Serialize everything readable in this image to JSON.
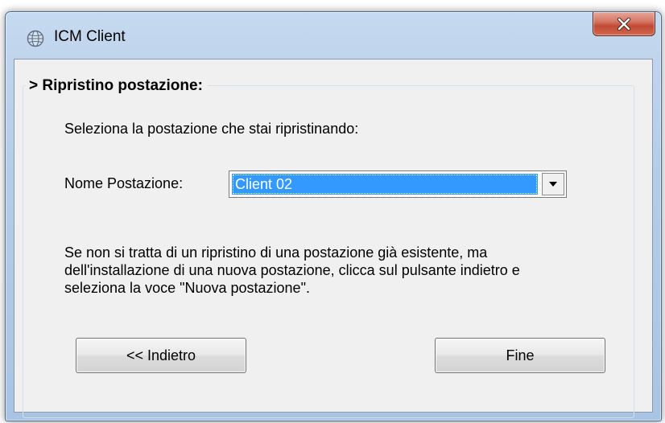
{
  "window": {
    "title": "ICM Client",
    "icon": "app-globe-icon",
    "close_icon": "close-x-icon",
    "close_glyph": "X"
  },
  "group": {
    "marker": ">",
    "title": "Ripristino postazione:"
  },
  "instructions": "Seleziona la postazione che stai ripristinando:",
  "workstation": {
    "label": "Nome Postazione:",
    "selected_value": "Client 02",
    "dropdown_icon": "chevron-down-icon"
  },
  "info_text": {
    "line1": "Se non si tratta di un ripristino di una postazione già esistente, ma",
    "line2": "dell'installazione di una nuova postazione, clicca sul pulsante indietro e",
    "line3": "seleziona la voce \"Nuova postazione\"."
  },
  "buttons": {
    "back_label": "<< Indietro",
    "finish_label": "Fine"
  },
  "colors": {
    "selection": "#3399ff",
    "close_button": "#c24a33",
    "frame": "#b6cde8"
  }
}
